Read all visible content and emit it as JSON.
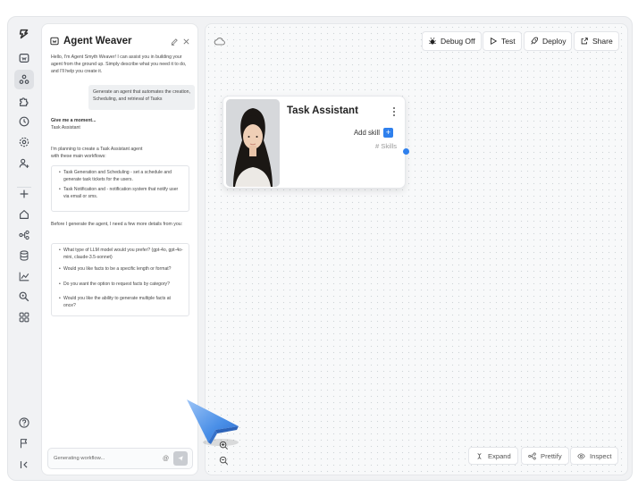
{
  "rail": {
    "icons": [
      "logo-icon",
      "bot-icon",
      "agents-icon",
      "puzzle-icon",
      "history-icon",
      "settings-icon",
      "user-add-icon",
      "plus-icon",
      "home-icon",
      "workflow-icon",
      "database-icon",
      "chart-icon",
      "search-key-icon",
      "grid-icon",
      "help-icon",
      "flag-icon",
      "collapse-icon"
    ]
  },
  "chat": {
    "title": "Agent Weaver",
    "intro": "Hello, I'm Agent Smyth Weaver! I can assist you in building your agent from the ground up. Simply describe what you need it to do, and I'll help you create it.",
    "user_message": "Generate an agent that automates the creation, Scheduling, and retrieval of Tasks",
    "reply_heading": "Give me a moment...",
    "reply_subheading": "Task Assistant",
    "plan_intro": "I'm planning to create a Task Assistant agent with these main workflows:",
    "workflows": [
      "Task Generation and Scheduling - set a schedule and generate task tickets for the users.",
      "Task Notification and - notification system that notify user via email or sms."
    ],
    "details_intro": "Before I generate the agent, I need a few more details from you:",
    "questions": [
      "What type of LLM model would you prefer? (gpt-4o, gpt-4o-mini, claude-3.5-sonnet)",
      "Would you like facts to be a specific length or format?",
      "Do you want the option to request facts by category?",
      "Would you like the ability to generate multiple facts at once?"
    ],
    "input_placeholder": "Generating workflow...",
    "at_symbol": "@"
  },
  "toolbar": {
    "debug_label": "Debug Off",
    "test_label": "Test",
    "deploy_label": "Deploy",
    "share_label": "Share"
  },
  "node": {
    "title": "Task Assistant",
    "add_skill_label": "Add skill",
    "plus_symbol": "+",
    "skills_label": "# Skills"
  },
  "bottom_bar": {
    "expand_label": "Expand",
    "prettify_label": "Prettify",
    "inspect_label": "Inspect"
  },
  "colors": {
    "accent": "#2f80ed",
    "cursor": "#4a8fe7"
  }
}
